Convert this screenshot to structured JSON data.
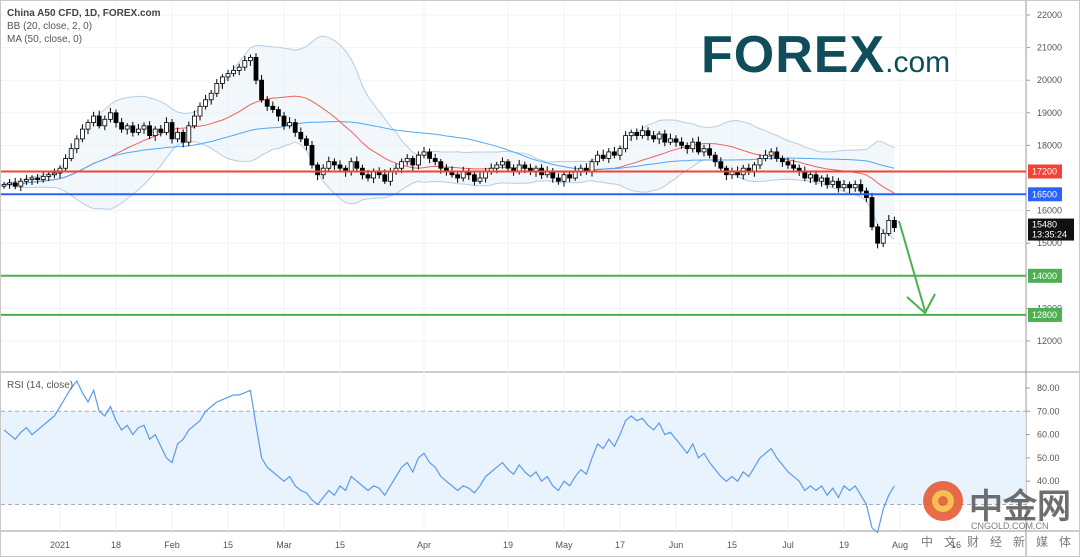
{
  "header": {
    "title": "China A50 CFD, 1D, FOREX.com",
    "bb": "BB (20, close, 2, 0)",
    "ma": "MA (50, close, 0)",
    "rsi": "RSI (14, close)"
  },
  "logo": {
    "main": "FOREX",
    "suffix": ".com"
  },
  "watermark": {
    "cn": "中金网",
    "url": "CNGOLD.COM.CN",
    "sub": "中文财经新媒体"
  },
  "colors": {
    "up": "#ffffff",
    "down": "#000000",
    "ma20": "#f0625a",
    "ma50": "#53a8f0",
    "bb": "#b8cde0",
    "red": "#f44336",
    "blue": "#2962ff",
    "green": "#4caf50",
    "rsi": "#5b9bea"
  },
  "chart_data": [
    {
      "type": "candlestick",
      "title": "China A50 CFD, 1D, FOREX.com",
      "ylim": [
        11500,
        22200
      ],
      "yticks": [
        22000,
        21000,
        20000,
        19000,
        18000,
        16000,
        15000,
        13000,
        12000
      ],
      "xticks": [
        {
          "i": 10,
          "label": "2021"
        },
        {
          "i": 20,
          "label": "18"
        },
        {
          "i": 30,
          "label": "Feb"
        },
        {
          "i": 40,
          "label": "15"
        },
        {
          "i": 50,
          "label": "Mar"
        },
        {
          "i": 60,
          "label": "15"
        },
        {
          "i": 75,
          "label": "Apr"
        },
        {
          "i": 90,
          "label": "19"
        },
        {
          "i": 100,
          "label": "May"
        },
        {
          "i": 110,
          "label": "17"
        },
        {
          "i": 120,
          "label": "Jun"
        },
        {
          "i": 130,
          "label": "15"
        },
        {
          "i": 140,
          "label": "Jul"
        },
        {
          "i": 150,
          "label": "19"
        },
        {
          "i": 160,
          "label": "Aug"
        },
        {
          "i": 170,
          "label": "16"
        }
      ],
      "levels": [
        {
          "value": 17200,
          "label": "17200",
          "color": "#f44336"
        },
        {
          "value": 16500,
          "label": "16500",
          "color": "#2962ff"
        },
        {
          "value": 14000,
          "label": "14000",
          "color": "#4caf50"
        },
        {
          "value": 12800,
          "label": "12800",
          "color": "#4caf50"
        }
      ],
      "last": {
        "price": "15480",
        "countdown": "13:35:24"
      },
      "closes": [
        16800,
        16850,
        16750,
        16900,
        16950,
        17000,
        16950,
        17050,
        17100,
        17150,
        17300,
        17600,
        17900,
        18200,
        18500,
        18700,
        18900,
        18600,
        18800,
        19000,
        18700,
        18500,
        18600,
        18400,
        18500,
        18600,
        18300,
        18500,
        18400,
        18700,
        18200,
        18400,
        18100,
        18600,
        18900,
        19200,
        19400,
        19600,
        19900,
        20100,
        20200,
        20300,
        20400,
        20600,
        20700,
        20000,
        19400,
        19200,
        19100,
        18900,
        18600,
        18700,
        18400,
        18200,
        18000,
        17400,
        17100,
        17300,
        17500,
        17400,
        17300,
        17200,
        17500,
        17300,
        17100,
        17000,
        17200,
        17100,
        16900,
        17200,
        17300,
        17500,
        17600,
        17400,
        17700,
        17800,
        17600,
        17500,
        17300,
        17200,
        17100,
        17000,
        17200,
        17100,
        16900,
        17000,
        17200,
        17300,
        17400,
        17500,
        17300,
        17200,
        17400,
        17300,
        17200,
        17300,
        17100,
        17200,
        17000,
        16900,
        17100,
        17000,
        17200,
        17300,
        17200,
        17500,
        17700,
        17600,
        17800,
        17700,
        17900,
        18300,
        18400,
        18300,
        18450,
        18300,
        18200,
        18350,
        18100,
        18200,
        18100,
        18000,
        17900,
        18100,
        17800,
        17900,
        17700,
        17500,
        17300,
        17100,
        17200,
        17100,
        17300,
        17200,
        17400,
        17600,
        17700,
        17800,
        17600,
        17500,
        17400,
        17300,
        17200,
        17000,
        17100,
        16900,
        17000,
        16800,
        16900,
        16700,
        16800,
        16700,
        16800,
        16600,
        16400,
        15500,
        15000,
        15300,
        15700,
        15480
      ]
    },
    {
      "type": "line",
      "title": "RSI (14, close)",
      "ylim": [
        10,
        88
      ],
      "yticks": [
        80,
        70,
        60,
        50,
        40
      ],
      "band": [
        30,
        70
      ],
      "values": [
        62,
        60,
        58,
        61,
        63,
        60,
        62,
        64,
        66,
        68,
        72,
        76,
        80,
        83,
        78,
        74,
        79,
        70,
        68,
        72,
        66,
        62,
        64,
        60,
        63,
        64,
        58,
        60,
        55,
        50,
        48,
        56,
        58,
        62,
        64,
        66,
        70,
        72,
        74,
        75,
        76,
        77,
        77,
        78,
        79,
        64,
        50,
        46,
        44,
        42,
        40,
        42,
        38,
        36,
        35,
        32,
        30,
        33,
        36,
        34,
        38,
        36,
        42,
        40,
        38,
        36,
        38,
        37,
        34,
        38,
        42,
        46,
        48,
        44,
        50,
        52,
        48,
        46,
        42,
        40,
        38,
        36,
        38,
        37,
        35,
        38,
        42,
        44,
        46,
        48,
        45,
        43,
        47,
        44,
        42,
        44,
        40,
        42,
        38,
        36,
        40,
        38,
        42,
        45,
        43,
        50,
        56,
        54,
        58,
        55,
        60,
        66,
        68,
        66,
        67,
        64,
        62,
        65,
        60,
        61,
        58,
        55,
        52,
        56,
        50,
        52,
        48,
        45,
        42,
        40,
        42,
        40,
        44,
        42,
        46,
        50,
        52,
        54,
        50,
        47,
        44,
        42,
        40,
        36,
        38,
        36,
        38,
        34,
        37,
        33,
        38,
        36,
        38,
        34,
        30,
        20,
        18,
        28,
        34,
        38
      ]
    }
  ]
}
